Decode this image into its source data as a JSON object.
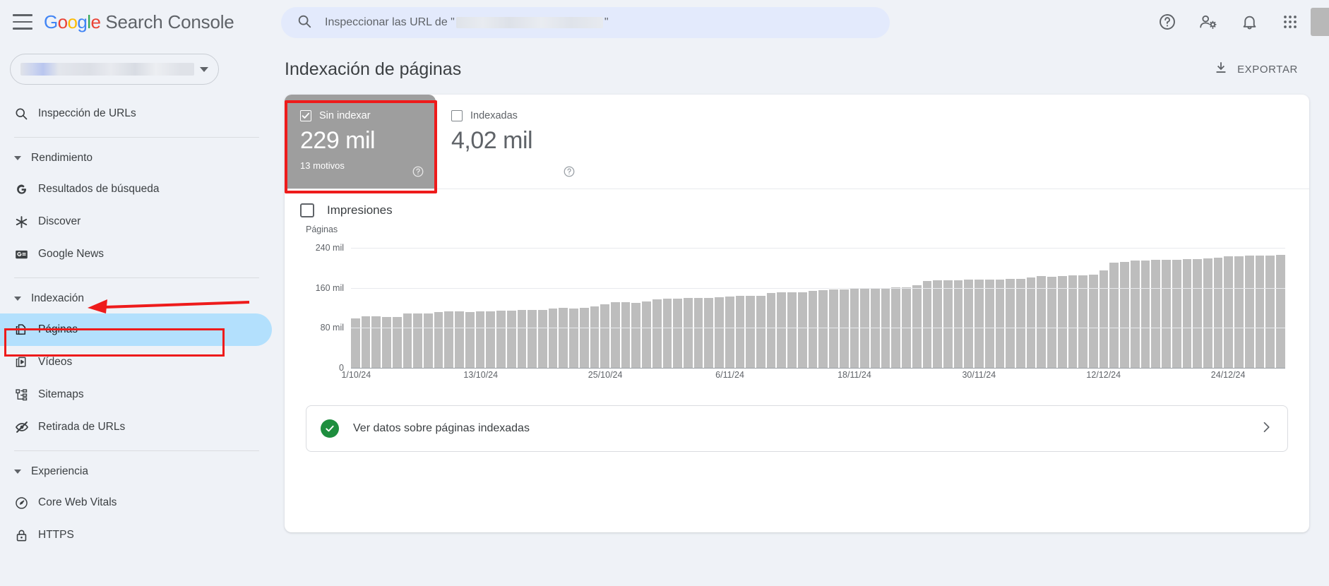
{
  "header": {
    "brand_google": "Google",
    "brand_product": "Search Console",
    "menu_label": "Menú principal",
    "search_prefix": "Inspeccionar las URL de \"",
    "search_suffix": "\"",
    "help_label": "Ayuda",
    "accounts_label": "Cambiar de cuenta",
    "notifications_label": "Notificaciones",
    "apps_label": "Aplicaciones de Google"
  },
  "sidebar": {
    "property_label": "Selector de propiedad",
    "url_inspection": "Inspección de URLs",
    "sections": [
      {
        "id": "rendimiento",
        "label": "Rendimiento",
        "items": [
          {
            "label": "Resultados de búsqueda",
            "icon": "google-g-icon"
          },
          {
            "label": "Discover",
            "icon": "discover-asterisk-icon"
          },
          {
            "label": "Google News",
            "icon": "google-news-icon"
          }
        ]
      },
      {
        "id": "indexacion",
        "label": "Indexación",
        "items": [
          {
            "label": "Páginas",
            "icon": "pages-copy-icon",
            "selected": true
          },
          {
            "label": "Vídeos",
            "icon": "videos-play-icon",
            "selected": false
          },
          {
            "label": "Sitemaps",
            "icon": "sitemaps-tree-icon",
            "selected": false
          },
          {
            "label": "Retirada de URLs",
            "icon": "eye-off-icon",
            "selected": false
          }
        ]
      },
      {
        "id": "experiencia",
        "label": "Experiencia",
        "items": [
          {
            "label": "Core Web Vitals",
            "icon": "speedometer-icon"
          },
          {
            "label": "HTTPS",
            "icon": "lock-icon"
          }
        ]
      }
    ]
  },
  "main": {
    "page_title": "Indexación de páginas",
    "export_label": "EXPORTAR",
    "metrics": [
      {
        "id": "sin-indexar",
        "label": "Sin indexar",
        "value": "229 mil",
        "sub": "13 motivos",
        "checked": true,
        "highlighted": true
      },
      {
        "id": "indexadas",
        "label": "Indexadas",
        "value": "4,02 mil",
        "sub": "",
        "checked": false,
        "highlighted": false
      }
    ],
    "impressions": {
      "label": "Impresiones",
      "checked": false
    },
    "banner": {
      "text": "Ver datos sobre páginas indexadas",
      "status": "ok"
    }
  },
  "chart_data": {
    "type": "bar",
    "title": "",
    "xlabel": "",
    "ylabel": "Páginas",
    "ylim": [
      0,
      260000
    ],
    "yticks": [
      0,
      80000,
      160000,
      240000
    ],
    "ytick_labels": [
      "0",
      "80 mil",
      "160 mil",
      "240 mil"
    ],
    "grid": true,
    "legend": "none",
    "series_name": "Sin indexar",
    "bar_color": "#bdbdbd",
    "xtick_labels": [
      "1/10/24",
      "13/10/24",
      "25/10/24",
      "6/11/24",
      "18/11/24",
      "30/11/24",
      "12/12/24",
      "24/12/24"
    ],
    "xtick_indices": [
      0,
      12,
      24,
      36,
      48,
      60,
      72,
      84
    ],
    "x": [
      "1/10/24",
      "2/10/24",
      "3/10/24",
      "4/10/24",
      "5/10/24",
      "6/10/24",
      "7/10/24",
      "8/10/24",
      "9/10/24",
      "10/10/24",
      "11/10/24",
      "12/10/24",
      "13/10/24",
      "14/10/24",
      "15/10/24",
      "16/10/24",
      "17/10/24",
      "18/10/24",
      "19/10/24",
      "20/10/24",
      "21/10/24",
      "22/10/24",
      "23/10/24",
      "24/10/24",
      "25/10/24",
      "26/10/24",
      "27/10/24",
      "28/10/24",
      "29/10/24",
      "30/10/24",
      "31/10/24",
      "1/11/24",
      "2/11/24",
      "3/11/24",
      "4/11/24",
      "5/11/24",
      "6/11/24",
      "7/11/24",
      "8/11/24",
      "9/11/24",
      "10/11/24",
      "11/11/24",
      "12/11/24",
      "13/11/24",
      "14/11/24",
      "15/11/24",
      "16/11/24",
      "17/11/24",
      "18/11/24",
      "19/11/24",
      "20/11/24",
      "21/11/24",
      "22/11/24",
      "23/11/24",
      "24/11/24",
      "25/11/24",
      "26/11/24",
      "27/11/24",
      "28/11/24",
      "29/11/24",
      "30/11/24",
      "1/12/24",
      "2/12/24",
      "3/12/24",
      "4/12/24",
      "5/12/24",
      "6/12/24",
      "7/12/24",
      "8/12/24",
      "9/12/24",
      "10/12/24",
      "11/12/24",
      "12/12/24",
      "13/12/24",
      "14/12/24",
      "15/12/24",
      "16/12/24",
      "17/12/24",
      "18/12/24",
      "19/12/24",
      "20/12/24",
      "21/12/24",
      "22/12/24",
      "23/12/24",
      "24/12/24",
      "25/12/24",
      "26/12/24",
      "27/12/24",
      "28/12/24"
    ],
    "values": [
      101000,
      104000,
      104000,
      103000,
      103000,
      110000,
      110000,
      110000,
      113000,
      114000,
      114000,
      113000,
      114000,
      114000,
      116000,
      116000,
      118000,
      118000,
      118000,
      120000,
      121000,
      120000,
      122000,
      124000,
      128000,
      133000,
      133000,
      132000,
      134000,
      139000,
      140000,
      140000,
      141000,
      142000,
      141000,
      143000,
      144000,
      145000,
      145000,
      146000,
      151000,
      152000,
      152000,
      152000,
      155000,
      157000,
      158000,
      158000,
      160000,
      160000,
      160000,
      160000,
      162000,
      162000,
      167000,
      175000,
      176000,
      176000,
      176000,
      178000,
      178000,
      178000,
      178000,
      179000,
      179000,
      182000,
      185000,
      184000,
      185000,
      186000,
      187000,
      188000,
      196000,
      212000,
      214000,
      216000,
      216000,
      217000,
      217000,
      218000,
      219000,
      219000,
      220000,
      222000,
      224000,
      225000,
      226000,
      226000,
      226000,
      227000
    ]
  }
}
